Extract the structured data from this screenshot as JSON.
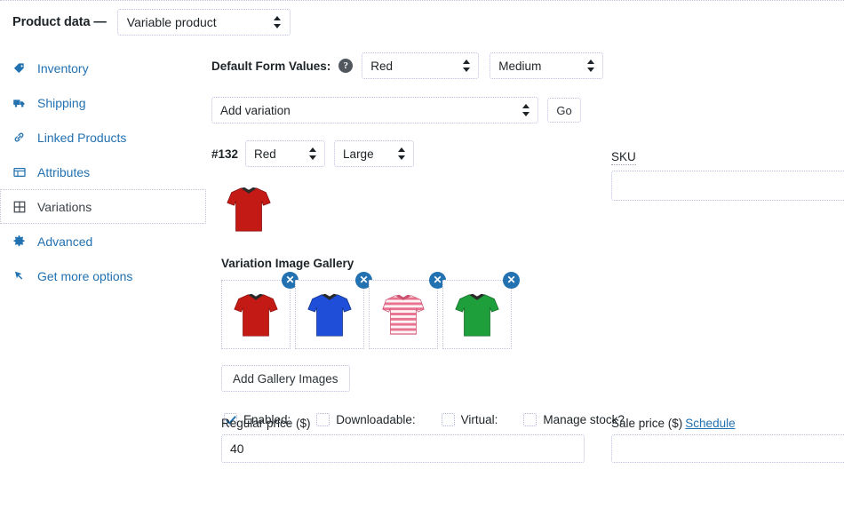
{
  "header": {
    "title": "Product data —",
    "product_type": "Variable product",
    "product_type_icon": "select-spinner-icon"
  },
  "sidebar": {
    "items": [
      {
        "label": "Inventory",
        "icon": "tag-icon",
        "active": false
      },
      {
        "label": "Shipping",
        "icon": "truck-icon",
        "active": false
      },
      {
        "label": "Linked Products",
        "icon": "link-icon",
        "active": false
      },
      {
        "label": "Attributes",
        "icon": "table-icon",
        "active": false
      },
      {
        "label": "Variations",
        "icon": "grid-icon",
        "active": true
      },
      {
        "label": "Advanced",
        "icon": "gear-icon",
        "active": false
      },
      {
        "label": "Get more options",
        "icon": "extension-icon",
        "active": false
      }
    ]
  },
  "variations": {
    "default_form_values_label": "Default Form Values:",
    "help_icon": "help-icon",
    "default_color": "Red",
    "default_size": "Medium",
    "add_variation_action": "Add variation",
    "go_button": "Go",
    "variation_id": "#132",
    "variation_color": "Red",
    "variation_size": "Large",
    "main_image_alt": "red-tshirt-image",
    "gallery_title": "Variation Image Gallery",
    "gallery": [
      {
        "alt": "red-tshirt-thumbnail",
        "remove": "✕"
      },
      {
        "alt": "blue-tshirt-thumbnail",
        "remove": "✕"
      },
      {
        "alt": "striped-tshirt-thumbnail",
        "remove": "✕"
      },
      {
        "alt": "green-tshirt-thumbnail",
        "remove": "✕"
      }
    ],
    "add_gallery_button": "Add Gallery Images",
    "checkboxes": [
      {
        "label": "Enabled:",
        "checked": true
      },
      {
        "label": "Downloadable:",
        "checked": false
      },
      {
        "label": "Virtual:",
        "checked": false
      },
      {
        "label": "Manage stock?",
        "checked": false
      }
    ],
    "sku_label": "SKU",
    "sku_value": "",
    "regular_price_label": "Regular price ($)",
    "regular_price_value": "40",
    "sale_price_label": "Sale price ($)",
    "schedule_link": "Schedule",
    "sale_price_value": ""
  },
  "colors": {
    "link": "#2271b1",
    "text": "#1d2327",
    "border_dotted": "#b9bddd",
    "shirt_red": "#c41a16",
    "shirt_blue": "#1f4fd8",
    "shirt_green": "#1f9e3c",
    "shirt_striped": "#e8728f"
  }
}
